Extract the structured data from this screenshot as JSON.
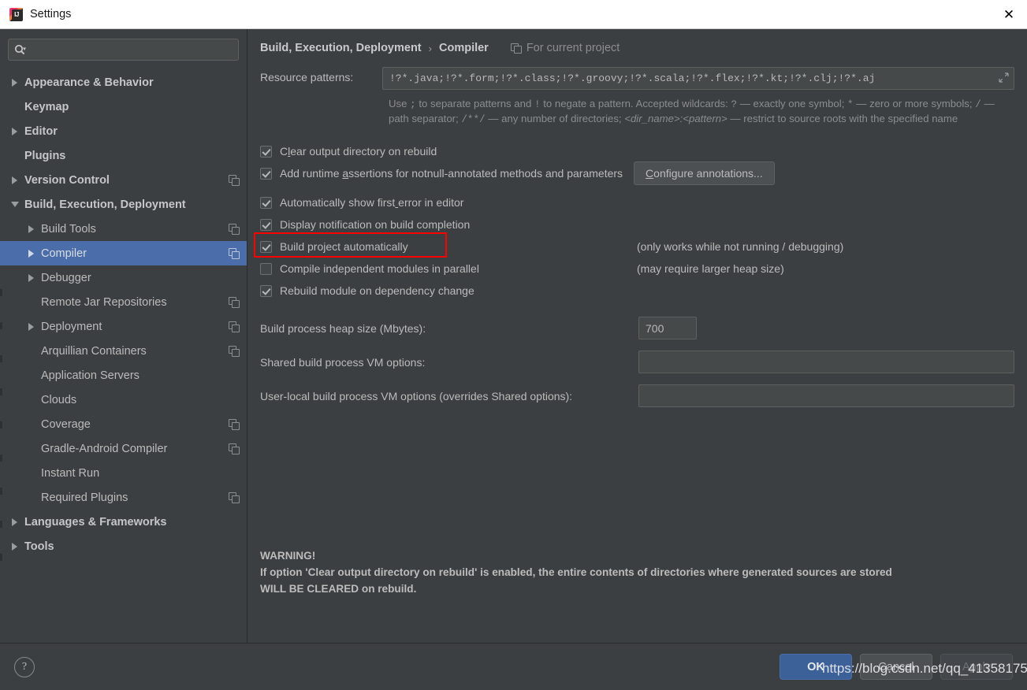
{
  "window": {
    "title": "Settings",
    "app_icon": "intellij-idea-icon",
    "close_label": "✕"
  },
  "sidebar": {
    "search": {
      "placeholder": "",
      "value": "",
      "icon": "search-icon"
    },
    "items": [
      {
        "label": "Appearance & Behavior",
        "level": 0,
        "bold": true,
        "arrow": "right",
        "copy": false
      },
      {
        "label": "Keymap",
        "level": 0,
        "bold": true,
        "arrow": "none",
        "copy": false
      },
      {
        "label": "Editor",
        "level": 0,
        "bold": true,
        "arrow": "right",
        "copy": false
      },
      {
        "label": "Plugins",
        "level": 0,
        "bold": true,
        "arrow": "none",
        "copy": false
      },
      {
        "label": "Version Control",
        "level": 0,
        "bold": true,
        "arrow": "right",
        "copy": true
      },
      {
        "label": "Build, Execution, Deployment",
        "level": 0,
        "bold": true,
        "arrow": "down",
        "copy": false
      },
      {
        "label": "Build Tools",
        "level": 1,
        "bold": false,
        "arrow": "right",
        "copy": true
      },
      {
        "label": "Compiler",
        "level": 1,
        "bold": false,
        "arrow": "right",
        "copy": true,
        "selected": true
      },
      {
        "label": "Debugger",
        "level": 1,
        "bold": false,
        "arrow": "right",
        "copy": false
      },
      {
        "label": "Remote Jar Repositories",
        "level": 2,
        "bold": false,
        "arrow": "none",
        "copy": true
      },
      {
        "label": "Deployment",
        "level": 1,
        "bold": false,
        "arrow": "right",
        "copy": true
      },
      {
        "label": "Arquillian Containers",
        "level": 2,
        "bold": false,
        "arrow": "none",
        "copy": true
      },
      {
        "label": "Application Servers",
        "level": 2,
        "bold": false,
        "arrow": "none",
        "copy": false
      },
      {
        "label": "Clouds",
        "level": 2,
        "bold": false,
        "arrow": "none",
        "copy": false
      },
      {
        "label": "Coverage",
        "level": 2,
        "bold": false,
        "arrow": "none",
        "copy": true
      },
      {
        "label": "Gradle-Android Compiler",
        "level": 2,
        "bold": false,
        "arrow": "none",
        "copy": true
      },
      {
        "label": "Instant Run",
        "level": 2,
        "bold": false,
        "arrow": "none",
        "copy": false
      },
      {
        "label": "Required Plugins",
        "level": 2,
        "bold": false,
        "arrow": "none",
        "copy": true
      },
      {
        "label": "Languages & Frameworks",
        "level": 0,
        "bold": true,
        "arrow": "right",
        "copy": false
      },
      {
        "label": "Tools",
        "level": 0,
        "bold": true,
        "arrow": "right",
        "copy": false
      }
    ]
  },
  "main": {
    "breadcrumb": {
      "root": "Build, Execution, Deployment",
      "separator": "›",
      "current": "Compiler",
      "scope": "For current project",
      "scope_icon": "copy-icon"
    },
    "resource_patterns": {
      "label": "Resource patterns:",
      "value": "!?*.java;!?*.form;!?*.class;!?*.groovy;!?*.scala;!?*.flex;!?*.kt;!?*.clj;!?*.aj",
      "expand_icon": "expand-icon"
    },
    "hint": {
      "part1": "Use ",
      "semi": ";",
      "part2": " to separate patterns and ",
      "bang": "!",
      "part3": " to negate a pattern. Accepted wildcards: ",
      "q": "?",
      "part4": " — exactly one symbol; ",
      "star": "*",
      "part5": " — zero or more symbols; ",
      "slash": "/",
      "part6": " — path separator; ",
      "globdir": "/**/",
      "part7": " — any number of directories; ",
      "dirpattern": "<dir_name>:<pattern>",
      "part8": " — restrict to source roots with the specified name"
    },
    "checkboxes": [
      {
        "label": "Clear output directory on rebuild",
        "checked": true,
        "mnemonic_index": 1
      },
      {
        "label": "Add runtime assertions for notnull-annotated methods and parameters",
        "checked": true,
        "mnemonic_index": 12
      },
      {
        "label": "Automatically show first error in editor",
        "checked": true,
        "mnemonic_index": 24
      },
      {
        "label": "Display notification on build completion",
        "checked": true,
        "mnemonic_index": -1
      },
      {
        "label": "Build project automatically",
        "checked": true,
        "mnemonic_index": -1,
        "highlighted": true
      },
      {
        "label": "Compile independent modules in parallel",
        "checked": false,
        "mnemonic_index": -1
      },
      {
        "label": "Rebuild module on dependency change",
        "checked": true,
        "mnemonic_index": -1
      }
    ],
    "configure_annotations_button": "Configure annotations...",
    "notes": {
      "build_auto": "(only works while not running / debugging)",
      "parallel": "(may require larger heap size)"
    },
    "fields": [
      {
        "label": "Build process heap size (Mbytes):",
        "value": "700",
        "kind": "small"
      },
      {
        "label": "Shared build process VM options:",
        "value": "",
        "kind": "wide"
      },
      {
        "label": "User-local build process VM options (overrides Shared options):",
        "value": "",
        "kind": "wide"
      }
    ],
    "warning": {
      "line1": "WARNING!",
      "line2": "If option 'Clear output directory on rebuild' is enabled, the entire contents of directories where generated sources are stored",
      "line3": "WILL BE CLEARED on rebuild."
    }
  },
  "footer": {
    "help": "?",
    "ok": "OK",
    "cancel": "Cancel",
    "apply": "Apply"
  },
  "watermark": "https://blog.csdn.net/qq_41358175",
  "colors": {
    "background": "#3c3f41",
    "selection": "#4b6eab",
    "text": "#bbbbbb",
    "field_bg": "#45494a",
    "highlight_box": "#ff0000",
    "ok_button": "#3c6199",
    "titlebar": "#ffffff"
  }
}
